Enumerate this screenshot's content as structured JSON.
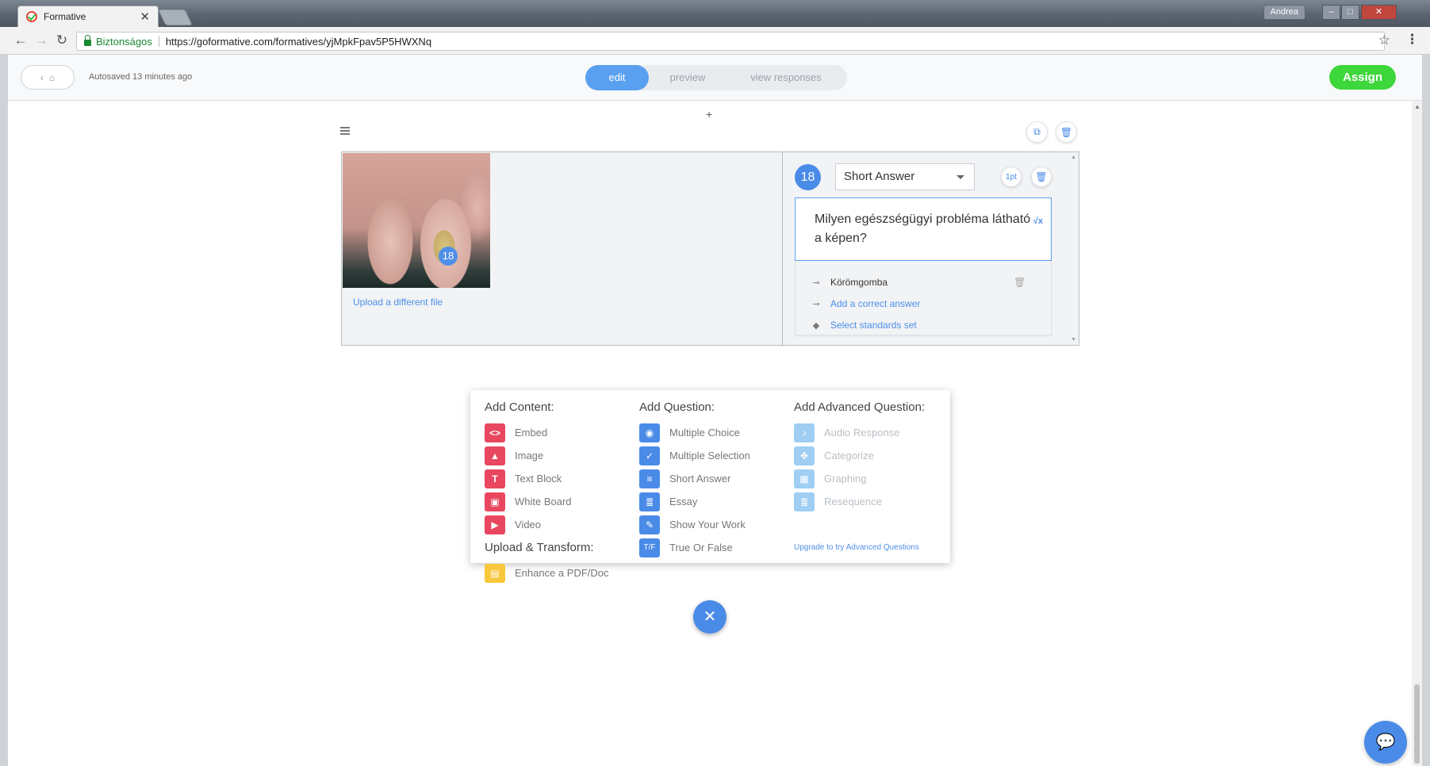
{
  "browser": {
    "tab_title": "Formative",
    "tab_close": "✕",
    "user_label": "Andrea",
    "min_glyph": "–",
    "max_glyph": "□",
    "close_glyph": "✕",
    "back_glyph": "←",
    "forward_glyph": "→",
    "reload_glyph": "↻",
    "secure_label": "Biztonságos",
    "url": "https://goformative.com/formatives/yjMpkFpav5P5HWXNq",
    "star_glyph": "☆",
    "menu_glyph": "⋮"
  },
  "header": {
    "home_chevron": "‹",
    "home_icon": "⌂",
    "autosave": "Autosaved 13 minutes ago",
    "modes": [
      "edit",
      "preview",
      "view responses"
    ],
    "assign_label": "Assign"
  },
  "block": {
    "plus": "+",
    "copy_icon": "⧉",
    "delete_icon": "🗑",
    "image_pin": "18",
    "upload_link": "Upload a different file",
    "question": {
      "number": "18",
      "type": "Short Answer",
      "points_label": "1pt",
      "delete_icon": "🗑",
      "text": "Milyen egészségügyi probléma látható a képen?",
      "math_icon": "√x",
      "answer": "Körömgomba",
      "add_answer": "Add a correct answer",
      "standards": "Select standards set"
    }
  },
  "add_menu": {
    "content_heading": "Add Content:",
    "content_items": [
      {
        "label": "Embed",
        "glyph": "<>"
      },
      {
        "label": "Image",
        "glyph": "▲"
      },
      {
        "label": "Text Block",
        "glyph": "T"
      },
      {
        "label": "White Board",
        "glyph": "▣"
      },
      {
        "label": "Video",
        "glyph": "▶"
      }
    ],
    "upload_heading": "Upload & Transform:",
    "upload_item": {
      "label": "Enhance a PDF/Doc",
      "glyph": "▤"
    },
    "question_heading": "Add Question:",
    "question_items": [
      {
        "label": "Multiple Choice",
        "glyph": "◉"
      },
      {
        "label": "Multiple Selection",
        "glyph": "✓"
      },
      {
        "label": "Short Answer",
        "glyph": "≡"
      },
      {
        "label": "Essay",
        "glyph": "≣"
      },
      {
        "label": "Show Your Work",
        "glyph": "✎"
      },
      {
        "label": "True Or False",
        "glyph": "T/F"
      }
    ],
    "advanced_heading": "Add Advanced Question:",
    "advanced_items": [
      {
        "label": "Audio Response",
        "glyph": "♪"
      },
      {
        "label": "Categorize",
        "glyph": "✥"
      },
      {
        "label": "Graphing",
        "glyph": "▦"
      },
      {
        "label": "Resequence",
        "glyph": "≣"
      }
    ],
    "upgrade_link": "Upgrade to try Advanced Questions"
  },
  "fab_glyph": "✕",
  "chat_glyph": "💬",
  "colors": {
    "primary_blue": "#4a8be8",
    "assign_green": "#3dd63b",
    "content_red": "#e8475f",
    "upload_yellow": "#f8c73c"
  }
}
